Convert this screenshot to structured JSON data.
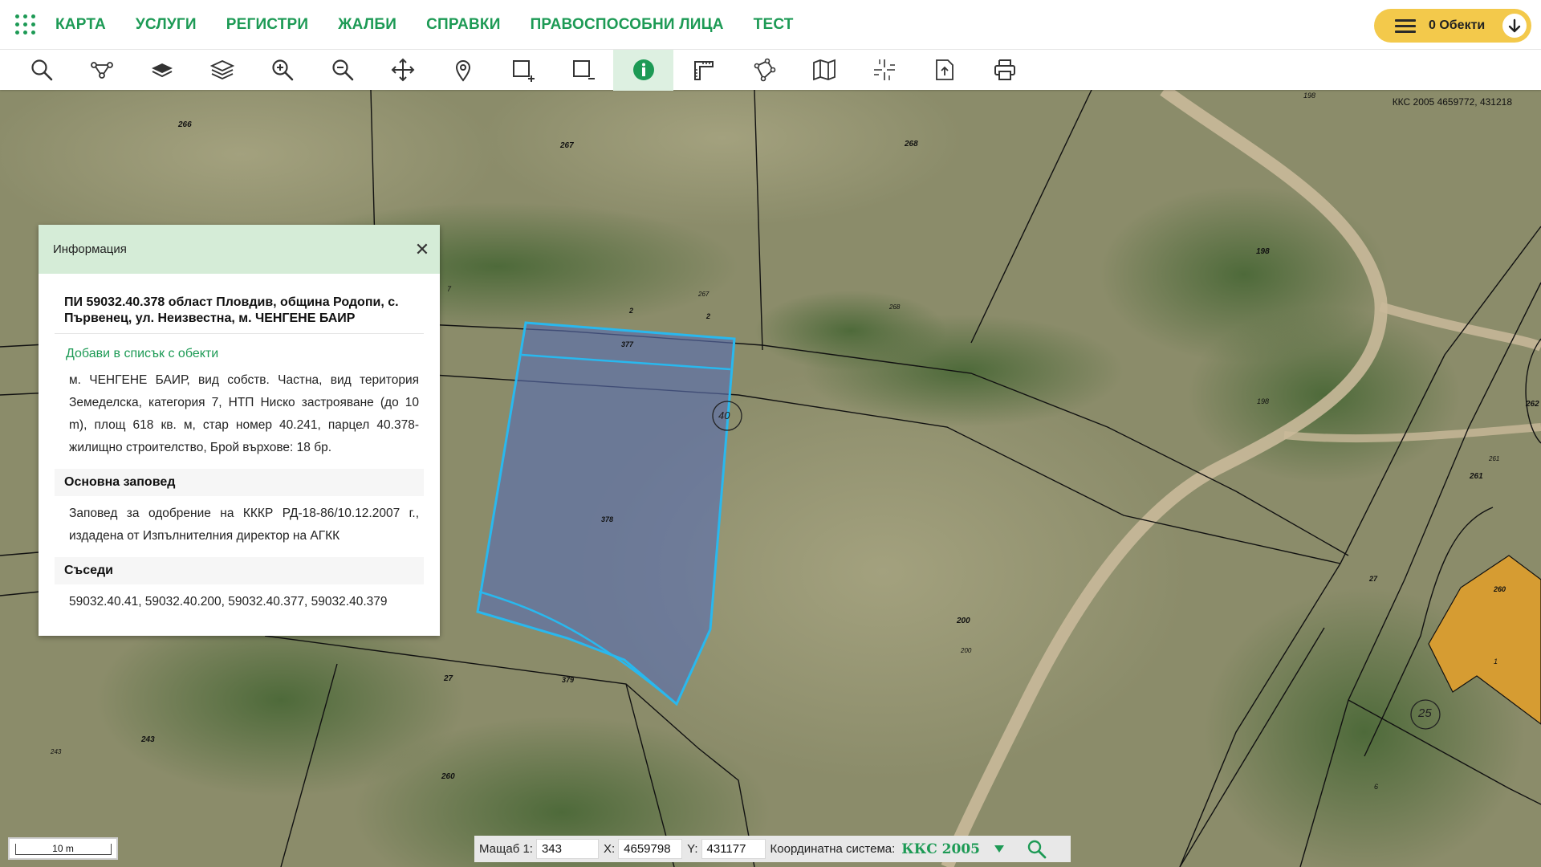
{
  "nav": {
    "items": [
      "КАРТА",
      "УСЛУГИ",
      "РЕГИСТРИ",
      "ЖАЛБИ",
      "СПРАВКИ",
      "ПРАВОСПОСОБНИ ЛИЦА",
      "ТЕСТ"
    ],
    "objects_label": "0 Обекти"
  },
  "toolbar": {
    "tools": [
      "search-icon",
      "route-icon",
      "layer-icon",
      "layers-icon",
      "zoom-in-icon",
      "zoom-out-icon",
      "pan-icon",
      "location-pin-icon",
      "select-rectangle-add-icon",
      "select-rectangle-remove-icon",
      "info-icon",
      "measure-icon",
      "polygon-icon",
      "map-icon",
      "crosshair-icon",
      "export-icon",
      "print-icon"
    ],
    "active": "info-icon",
    "accent": "#1d9a55"
  },
  "map": {
    "coord_readout": "ККС 2005 4659772, 431218",
    "labels": [
      "266",
      "267",
      "268",
      "198",
      "198",
      "198",
      "2",
      "2",
      "267",
      "268",
      "377",
      "378",
      "379",
      "40",
      "200",
      "200",
      "27",
      "261",
      "261",
      "262",
      "260",
      "1",
      "25",
      "243",
      "243",
      "260",
      "27",
      "6",
      "7"
    ],
    "selected_parcel_color": "#29b8ee"
  },
  "info": {
    "header": "Информация",
    "title": "ПИ 59032.40.378 област Пловдив, община Родопи, с. Първенец, ул. Неизвестна, м. ЧЕНГЕНЕ БАИР",
    "add_link": "Добави в списък с обекти",
    "description": "м. ЧЕНГЕНЕ БАИР, вид собств. Частна, вид територия Земеделска, категория 7, НТП Ниско застрояване (до 10 m), площ 618 кв. м, стар номер 40.241, парцел 40.378-жилищно строителство, Брой върхове: 18 бр.",
    "order_heading": "Основна заповед",
    "order_text": "Заповед за одобрение на КККР РД-18-86/10.12.2007 г., издадена от Изпълнителния директор на АГКК",
    "neighbors_heading": "Съседи",
    "neighbors_text": "59032.40.41, 59032.40.200, 59032.40.377, 59032.40.379"
  },
  "status": {
    "scale_bar": "10 m",
    "scale_label": "Мащаб 1:",
    "scale_value": "343",
    "x_label": "X:",
    "x_value": "4659798",
    "y_label": "Y:",
    "y_value": "431177",
    "cs_label": "Координатна система:",
    "cs_value": "ККС 2005"
  }
}
